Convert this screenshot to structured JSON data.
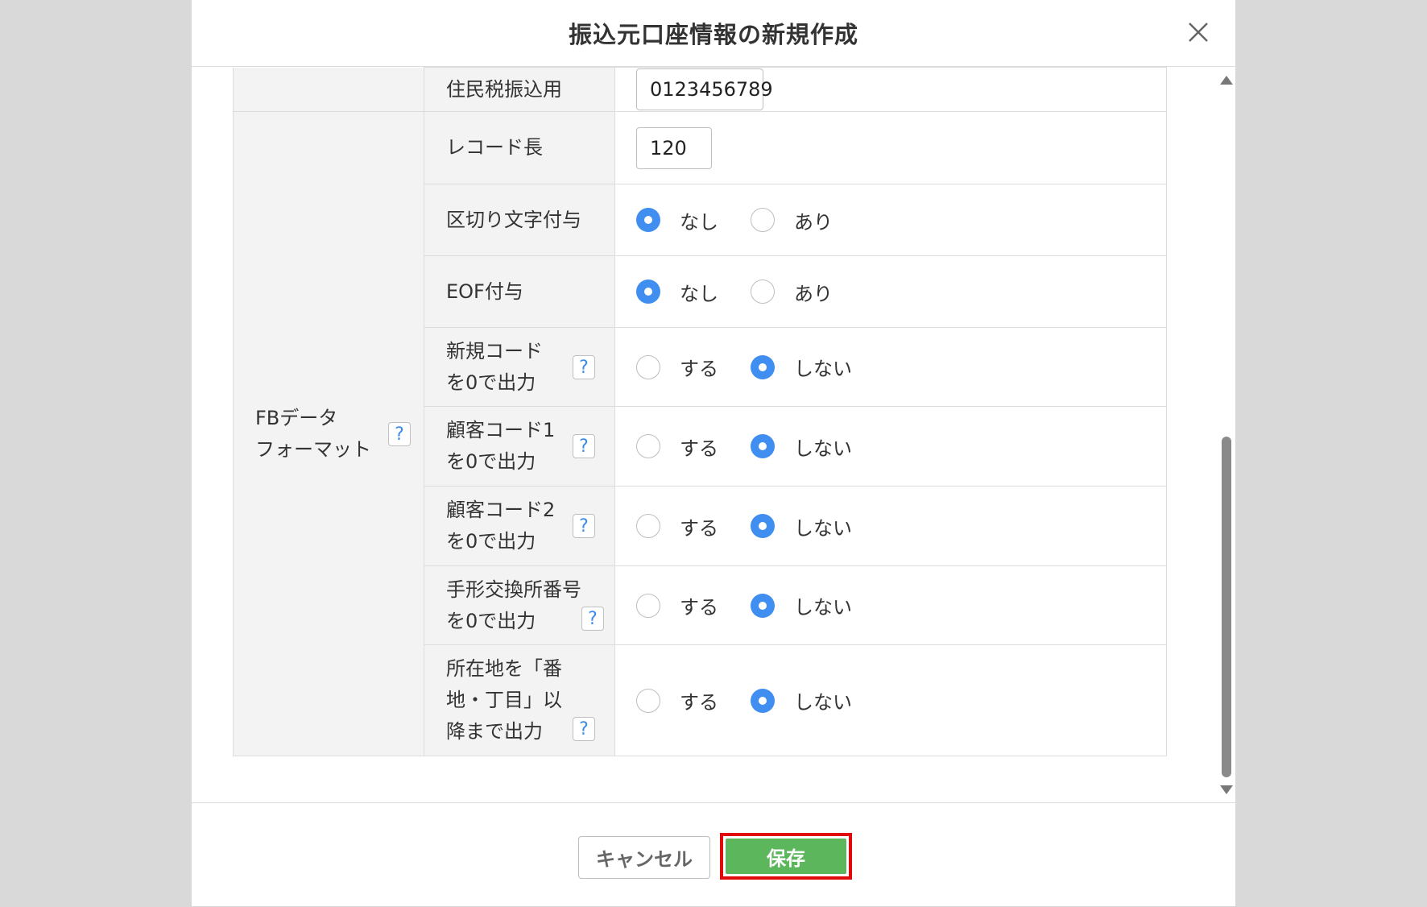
{
  "dialog": {
    "title": "振込元口座情報の新規作成",
    "close_icon": "close-icon"
  },
  "form": {
    "top_row": {
      "label": "住民税振込用",
      "value": "0123456789"
    },
    "group_label": [
      "FBデータ",
      "フォーマット"
    ],
    "help_symbol": "?",
    "record_length": {
      "label": "レコード長",
      "value": "120"
    },
    "delimiter": {
      "label": "区切り文字付与",
      "options": [
        "なし",
        "あり"
      ],
      "selected": "なし"
    },
    "eof": {
      "label": "EOF付与",
      "options": [
        "なし",
        "あり"
      ],
      "selected": "なし"
    },
    "new_code_zero": {
      "label": [
        "新規コード",
        "を0で出力"
      ],
      "options": [
        "する",
        "しない"
      ],
      "selected": "しない"
    },
    "customer_code1_zero": {
      "label": [
        "顧客コード1",
        "を0で出力"
      ],
      "options": [
        "する",
        "しない"
      ],
      "selected": "しない"
    },
    "customer_code2_zero": {
      "label": [
        "顧客コード2",
        "を0で出力"
      ],
      "options": [
        "する",
        "しない"
      ],
      "selected": "しない"
    },
    "clearing_house_zero": {
      "label": [
        "手形交換所番号",
        "を0で出力"
      ],
      "options": [
        "する",
        "しない"
      ],
      "selected": "しない"
    },
    "address_output": {
      "label": [
        "所在地を「番",
        "地・丁目」以",
        "降まで出力"
      ],
      "options": [
        "する",
        "しない"
      ],
      "selected": "しない"
    }
  },
  "footer": {
    "cancel_label": "キャンセル",
    "save_label": "保存"
  },
  "colors": {
    "radio_selected": "#3f8ef0",
    "save_button": "#5cb65c",
    "highlight_border": "#e10a0a"
  }
}
